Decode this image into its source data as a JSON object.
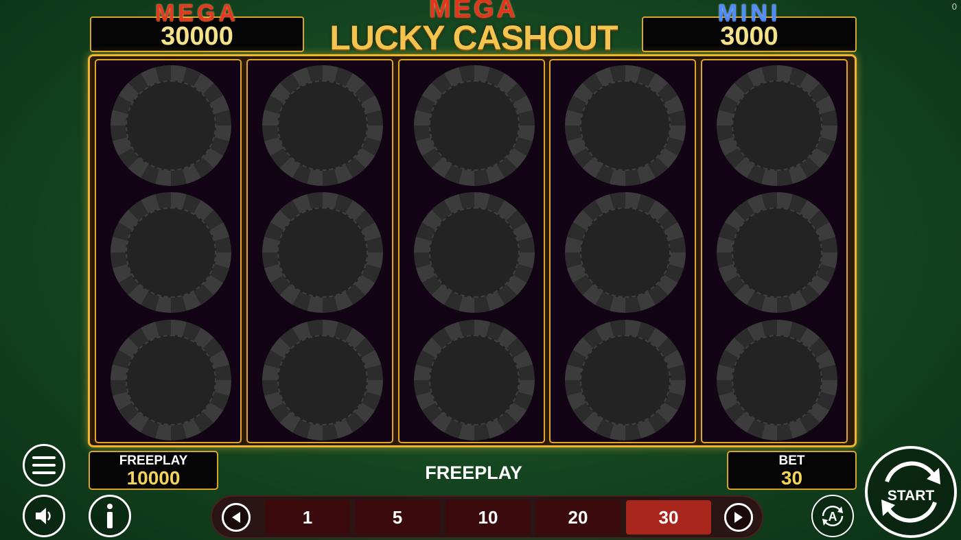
{
  "corner_counter": "0",
  "jackpots": {
    "left": {
      "label": "MEGA",
      "value": "30000"
    },
    "right": {
      "label": "MINI",
      "value": "3000"
    }
  },
  "logo": {
    "line1": "MEGA",
    "line2": "LUCKY CASHOUT"
  },
  "reels": {
    "columns": 5,
    "rows": 3,
    "symbol_icon": "poker-chip-icon"
  },
  "freeplay_box": {
    "label": "FREEPLAY",
    "value": "10000"
  },
  "status_text": "FREEPLAY",
  "bet_box": {
    "label": "BET",
    "value": "30"
  },
  "bet_options": [
    "1",
    "5",
    "10",
    "20",
    "30"
  ],
  "selected_bet": "30",
  "start_button": {
    "label": "START"
  },
  "icons": {
    "menu": "menu-icon",
    "sound": "speaker-icon",
    "info": "info-icon",
    "autoplay": "autoplay-icon",
    "prev": "arrow-left-icon",
    "next": "arrow-right-icon"
  },
  "colors": {
    "gold": "#d8a527",
    "selected_bet": "#a8261c",
    "jackpot_value": "#f4e28a"
  }
}
